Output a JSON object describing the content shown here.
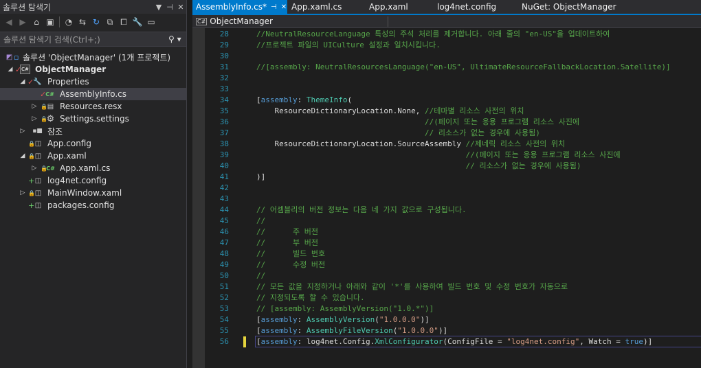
{
  "solution_explorer": {
    "title": "솔루션 탐색기",
    "title_controls": [
      "▼",
      "⊣",
      "✕"
    ],
    "search_placeholder": "솔루션 탐색기 검색(Ctrl+;)",
    "tree": [
      {
        "label": "솔루션 'ObjectManager' (1개 프로젝트)",
        "icon": "solution-icon"
      },
      {
        "label": "ObjectManager",
        "icon": "csproj-icon",
        "bold": true
      },
      {
        "label": "Properties",
        "icon": "wrench-icon"
      },
      {
        "label": "AssemblyInfo.cs",
        "icon": "csharp-file-icon",
        "selected": true
      },
      {
        "label": "Resources.resx",
        "icon": "resx-file-icon"
      },
      {
        "label": "Settings.settings",
        "icon": "settings-gear-icon"
      },
      {
        "label": "참조",
        "icon": "references-icon"
      },
      {
        "label": "App.config",
        "icon": "config-file-icon"
      },
      {
        "label": "App.xaml",
        "icon": "xaml-file-icon"
      },
      {
        "label": "App.xaml.cs",
        "icon": "csharp-file-icon"
      },
      {
        "label": "log4net.config",
        "icon": "config-file-icon"
      },
      {
        "label": "MainWindow.xaml",
        "icon": "xaml-file-icon"
      },
      {
        "label": "packages.config",
        "icon": "config-file-icon"
      }
    ]
  },
  "tabs": [
    {
      "label": "AssemblyInfo.cs*",
      "active": true
    },
    {
      "label": "App.xaml.cs"
    },
    {
      "label": "App.xaml"
    },
    {
      "label": "log4net.config"
    },
    {
      "label": "NuGet: ObjectManager"
    }
  ],
  "nav_bar": {
    "project": "ObjectManager",
    "cs_badge": "C#"
  },
  "editor": {
    "lines": [
      {
        "n": "28",
        "parts": [
          [
            "c",
            "//NeutralResourceLanguage 특성의 주석 처리를 제거합니다. 아래 줄의 \"en-US\"을 업데이트하여"
          ]
        ]
      },
      {
        "n": "29",
        "parts": [
          [
            "c",
            "//프로젝트 파일의 UICulture 설정과 일치시킵니다."
          ]
        ]
      },
      {
        "n": "30",
        "parts": []
      },
      {
        "n": "31",
        "parts": [
          [
            "c",
            "//[assembly: NeutralResourcesLanguage(\"en-US\", UltimateResourceFallbackLocation.Satellite)]"
          ]
        ]
      },
      {
        "n": "32",
        "parts": []
      },
      {
        "n": "33",
        "parts": []
      },
      {
        "n": "34",
        "parts": [
          [
            "p",
            "["
          ],
          [
            "k",
            "assembly"
          ],
          [
            "p",
            ": "
          ],
          [
            "ty",
            "ThemeInfo"
          ],
          [
            "p",
            "("
          ]
        ]
      },
      {
        "n": "35",
        "parts": [
          [
            "p",
            "    ResourceDictionaryLocation.None, "
          ],
          [
            "c",
            "//테마별 리소스 사전의 위치"
          ]
        ]
      },
      {
        "n": "36",
        "parts": [
          [
            "p",
            "                                     "
          ],
          [
            "c",
            "//(페이지 또는 응용 프로그램 리소스 사진에"
          ]
        ]
      },
      {
        "n": "37",
        "parts": [
          [
            "p",
            "                                     "
          ],
          [
            "c",
            "// 리소스가 없는 경우에 사용됨)"
          ]
        ]
      },
      {
        "n": "38",
        "parts": [
          [
            "p",
            "    ResourceDictionaryLocation.SourceAssembly "
          ],
          [
            "c",
            "//제네릭 리소스 사전의 위치"
          ]
        ]
      },
      {
        "n": "39",
        "parts": [
          [
            "p",
            "                                              "
          ],
          [
            "c",
            "//(페이지 또는 응용 프로그램 리소스 사진에"
          ]
        ]
      },
      {
        "n": "40",
        "parts": [
          [
            "p",
            "                                              "
          ],
          [
            "c",
            "// 리소스가 없는 경우에 사용됨)"
          ]
        ]
      },
      {
        "n": "41",
        "parts": [
          [
            "p",
            ")]"
          ]
        ]
      },
      {
        "n": "42",
        "parts": []
      },
      {
        "n": "43",
        "parts": []
      },
      {
        "n": "44",
        "parts": [
          [
            "c",
            "// 어셈블리의 버전 정보는 다음 네 가지 값으로 구성됩니다."
          ]
        ]
      },
      {
        "n": "45",
        "parts": [
          [
            "c",
            "//"
          ]
        ]
      },
      {
        "n": "46",
        "parts": [
          [
            "c",
            "//      주 버전"
          ]
        ]
      },
      {
        "n": "47",
        "parts": [
          [
            "c",
            "//      부 버전"
          ]
        ]
      },
      {
        "n": "48",
        "parts": [
          [
            "c",
            "//      빌드 번호"
          ]
        ]
      },
      {
        "n": "49",
        "parts": [
          [
            "c",
            "//      수정 버전"
          ]
        ]
      },
      {
        "n": "50",
        "parts": [
          [
            "c",
            "//"
          ]
        ]
      },
      {
        "n": "51",
        "parts": [
          [
            "c",
            "// 모든 값을 지정하거나 아래와 같이 '*'를 사용하여 빌드 번호 및 수정 번호가 자동으로"
          ]
        ]
      },
      {
        "n": "52",
        "parts": [
          [
            "c",
            "// 지정되도록 할 수 있습니다."
          ]
        ]
      },
      {
        "n": "53",
        "parts": [
          [
            "c",
            "// [assembly: AssemblyVersion(\"1.0.*\")]"
          ]
        ]
      },
      {
        "n": "54",
        "parts": [
          [
            "p",
            "["
          ],
          [
            "k",
            "assembly"
          ],
          [
            "p",
            ": "
          ],
          [
            "ty",
            "AssemblyVersion"
          ],
          [
            "p",
            "("
          ],
          [
            "s",
            "\"1.0.0.0\""
          ],
          [
            "p",
            ")]"
          ]
        ]
      },
      {
        "n": "55",
        "parts": [
          [
            "p",
            "["
          ],
          [
            "k",
            "assembly"
          ],
          [
            "p",
            ": "
          ],
          [
            "ty",
            "AssemblyFileVersion"
          ],
          [
            "p",
            "("
          ],
          [
            "s",
            "\"1.0.0.0\""
          ],
          [
            "p",
            ")]"
          ]
        ]
      },
      {
        "n": "56",
        "parts": [
          [
            "p",
            "["
          ],
          [
            "k",
            "assembly"
          ],
          [
            "p",
            ": log4net.Config."
          ],
          [
            "ty",
            "XmlConfigurator"
          ],
          [
            "p",
            "(ConfigFile = "
          ],
          [
            "s",
            "\"log4net.config\""
          ],
          [
            "p",
            ", Watch = "
          ],
          [
            "k",
            "true"
          ],
          [
            "p",
            ")]"
          ]
        ]
      }
    ]
  },
  "colors": {
    "accent": "#007acc",
    "comment": "#57a64a",
    "keyword": "#569cd6",
    "type": "#4ec9b0",
    "string": "#d69d85",
    "line_number": "#2b91af"
  }
}
